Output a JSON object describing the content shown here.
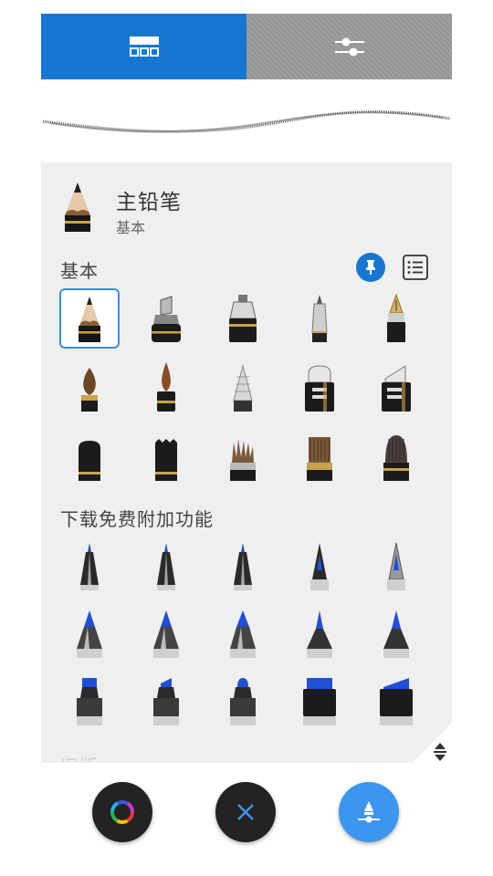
{
  "panel": {
    "current_brush": {
      "name": "主铅笔",
      "category": "基本"
    },
    "sections": [
      {
        "label": "基本"
      },
      {
        "label": "下载免费附加功能"
      },
      {
        "label": "旧版"
      }
    ],
    "grid_basic": [
      [
        "pencil",
        "chisel-marker",
        "ink-pen",
        "ballpoint-pen",
        "fountain-pen"
      ],
      [
        "round-brush",
        "pointed-brush",
        "airbrush",
        "flat-marker",
        "angled-marker"
      ],
      [
        "soft-eraser",
        "texture-eraser",
        "bristle-brush",
        "fan-brush",
        "wide-brush"
      ]
    ],
    "grid_addons": [
      [
        "fine-liner-1",
        "fine-liner-2",
        "fine-liner-3",
        "calligraphy-nib",
        "technical-nib"
      ],
      [
        "cone-marker-1",
        "cone-marker-2",
        "cone-marker-3",
        "cone-marker-4",
        "cone-marker-5"
      ],
      [
        "chisel-marker-blue-1",
        "chisel-marker-blue-2",
        "round-marker-blue",
        "stamp-marker",
        "wedge-marker"
      ]
    ]
  },
  "colors": {
    "accent": "#1677d2",
    "fab_blue": "#3d96ee",
    "fab_dark": "#232323",
    "panel_bg": "#efefef",
    "ink_blue": "#1f4fd6"
  },
  "toolbar": {
    "icons": [
      "brush-library-grid-icon",
      "brush-properties-sliders-icon"
    ]
  },
  "bottom_buttons": [
    "color-wheel-button",
    "close-button",
    "brush-tool-button"
  ]
}
